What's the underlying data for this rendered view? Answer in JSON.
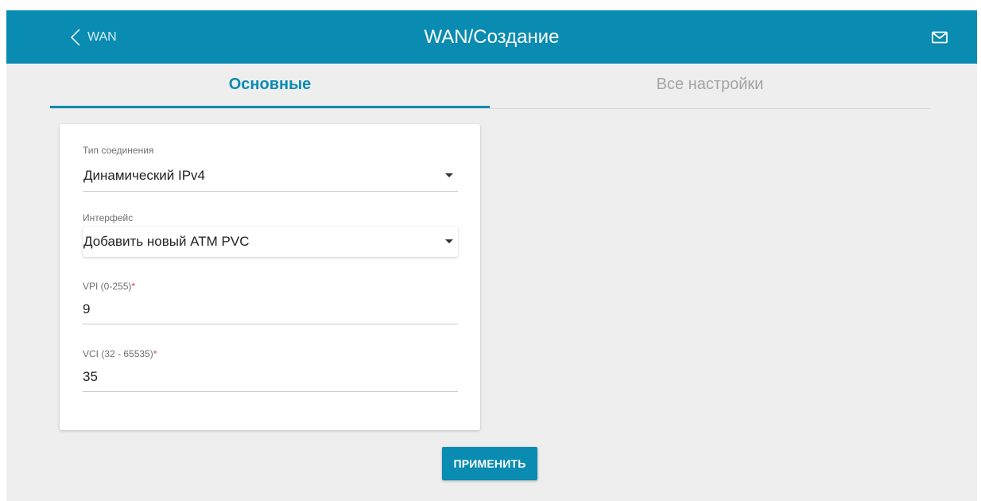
{
  "header": {
    "back_label": "WAN",
    "title": "WAN/Создание",
    "mail_icon": "envelope-icon"
  },
  "tabs": [
    {
      "label": "Основные",
      "active": true
    },
    {
      "label": "Все настройки",
      "active": false
    }
  ],
  "form": {
    "connection_type": {
      "label": "Тип соединения",
      "value": "Динамический IPv4"
    },
    "interface": {
      "label": "Интерфейс",
      "value": "Добавить новый ATM PVC"
    },
    "vpi": {
      "label": "VPI (0-255)",
      "required_mark": "*",
      "value": "9"
    },
    "vci": {
      "label": "VCI (32 - 65535)",
      "required_mark": "*",
      "value": "35"
    }
  },
  "actions": {
    "apply_label": "ПРИМЕНИТЬ"
  },
  "colors": {
    "accent": "#0a8bb1",
    "background": "#eeeeee",
    "required": "#e53935"
  }
}
